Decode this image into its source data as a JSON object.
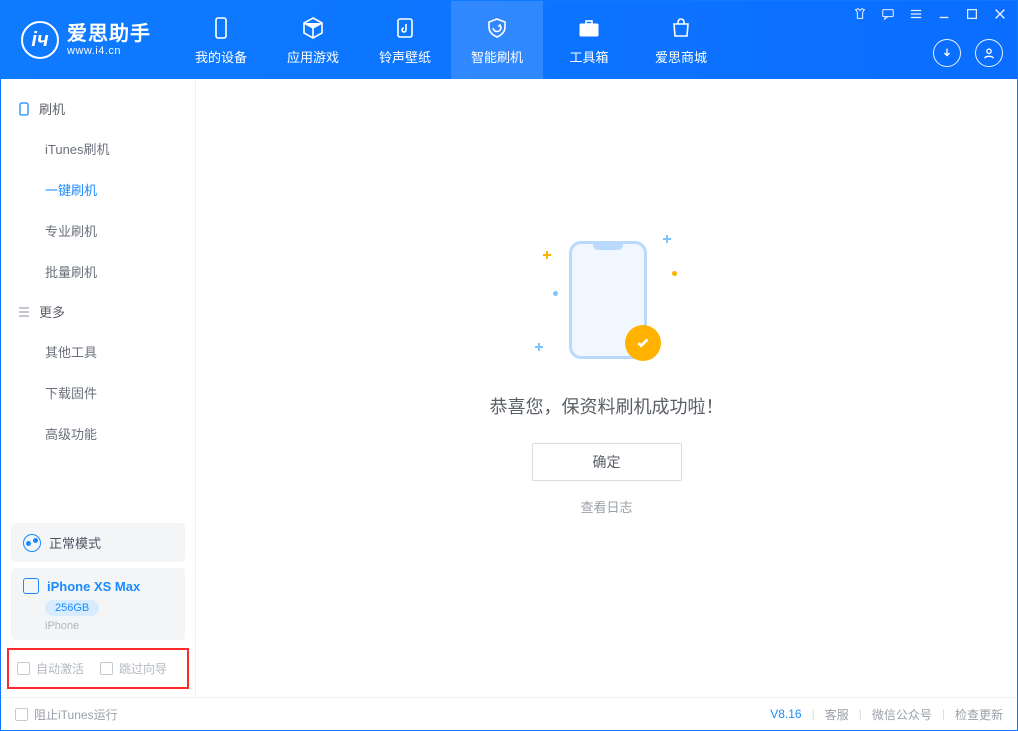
{
  "app": {
    "title": "爱思助手",
    "site": "www.i4.cn"
  },
  "tabs": {
    "0": "我的设备",
    "1": "应用游戏",
    "2": "铃声壁纸",
    "3": "智能刷机",
    "4": "工具箱",
    "5": "爱思商城"
  },
  "sidebar": {
    "group_flash": "刷机",
    "items_flash": {
      "0": "iTunes刷机",
      "1": "一键刷机",
      "2": "专业刷机",
      "3": "批量刷机"
    },
    "group_more": "更多",
    "items_more": {
      "0": "其他工具",
      "1": "下载固件",
      "2": "高级功能"
    },
    "mode": "正常模式",
    "device": {
      "name": "iPhone XS Max",
      "capacity": "256GB",
      "type": "iPhone"
    },
    "opts": {
      "auto_activate": "自动激活",
      "skip_guide": "跳过向导"
    }
  },
  "main": {
    "success_title": "恭喜您，保资料刷机成功啦！",
    "ok": "确定",
    "view_log": "查看日志"
  },
  "status": {
    "block_itunes": "阻止iTunes运行",
    "version": "V8.16",
    "support": "客服",
    "wechat": "微信公众号",
    "check_update": "检查更新"
  }
}
